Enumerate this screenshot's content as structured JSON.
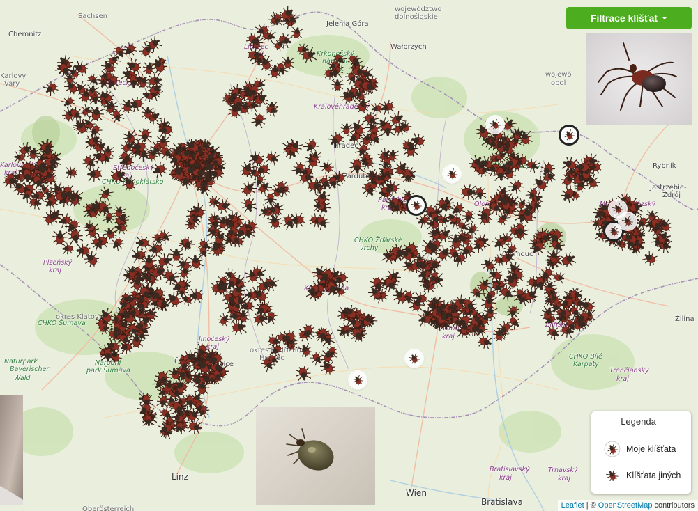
{
  "filter_button": {
    "label": "Filtrace klíšťat"
  },
  "legend": {
    "title": "Legenda",
    "own_label": "Moje klíšťata",
    "others_label": "Klíšťata jiných"
  },
  "attribution": {
    "leaflet": "Leaflet",
    "separator": "| ©",
    "osm": "OpenStreetMap",
    "contributors": "contributors"
  },
  "map_labels": [
    {
      "text": "Sachsen",
      "cls": ""
    },
    {
      "text": "Chemnitz",
      "cls": "city"
    },
    {
      "text": "Liberec",
      "cls": "region"
    },
    {
      "text": "kraj",
      "cls": "region"
    },
    {
      "text": "województwo",
      "cls": ""
    },
    {
      "text": "dolnośląskie",
      "cls": ""
    },
    {
      "text": "Jelenia Góra",
      "cls": "city"
    },
    {
      "text": "Wałbrzych",
      "cls": "city"
    },
    {
      "text": "Krkonošský",
      "cls": "green"
    },
    {
      "text": "národní",
      "cls": "green"
    },
    {
      "text": "park",
      "cls": "green"
    },
    {
      "text": "Ústecký",
      "cls": "region"
    },
    {
      "text": "Královéhradecký",
      "cls": "region"
    },
    {
      "text": "Hradec",
      "cls": "city"
    },
    {
      "text": "Pardubice",
      "cls": "city"
    },
    {
      "text": "Pardubický",
      "cls": "region"
    },
    {
      "text": "kraj",
      "cls": "region"
    },
    {
      "text": "Olomoucký",
      "cls": "region"
    },
    {
      "text": "Olomouc",
      "cls": "city"
    },
    {
      "text": "CHKO Jeseníky",
      "cls": "green"
    },
    {
      "text": "Moravskoslezský",
      "cls": "region"
    },
    {
      "text": "Středočeský",
      "cls": "region"
    },
    {
      "text": "kraj",
      "cls": "region"
    },
    {
      "text": "CHKO Křivoklátsko",
      "cls": "green"
    },
    {
      "text": "Plzeňský",
      "cls": "region"
    },
    {
      "text": "kraj",
      "cls": "region"
    },
    {
      "text": "Karlovarský",
      "cls": "region"
    },
    {
      "text": "kraj",
      "cls": "region"
    },
    {
      "text": "okres Klatovy",
      "cls": ""
    },
    {
      "text": "CHKO Šumava",
      "cls": "green"
    },
    {
      "text": "Naturpark",
      "cls": "green"
    },
    {
      "text": "Bayerischer",
      "cls": "green"
    },
    {
      "text": "Wald",
      "cls": "green"
    },
    {
      "text": "Národní",
      "cls": "green"
    },
    {
      "text": "park Šumava",
      "cls": "green"
    },
    {
      "text": "Jihočeský",
      "cls": "region"
    },
    {
      "text": "kraj",
      "cls": "region"
    },
    {
      "text": "České",
      "cls": "city"
    },
    {
      "text": "Budějovice",
      "cls": "city"
    },
    {
      "text": "okres Jindřichův",
      "cls": ""
    },
    {
      "text": "Hradec",
      "cls": ""
    },
    {
      "text": "Kraj Vysočina",
      "cls": "region"
    },
    {
      "text": "CHKO Žďárské",
      "cls": "green"
    },
    {
      "text": "vrchy",
      "cls": "green"
    },
    {
      "text": "Jihomoravský",
      "cls": "region"
    },
    {
      "text": "kraj",
      "cls": "region"
    },
    {
      "text": "Zlínský kraj",
      "cls": "region"
    },
    {
      "text": "CHKO Bílé",
      "cls": "green"
    },
    {
      "text": "Karpaty",
      "cls": "green"
    },
    {
      "text": "Trenčiansky",
      "cls": "region"
    },
    {
      "text": "kraj",
      "cls": "region"
    },
    {
      "text": "Žilina",
      "cls": "city"
    },
    {
      "text": "Rybník",
      "cls": "city"
    },
    {
      "text": "Jastrzębie-",
      "cls": "city"
    },
    {
      "text": "Zdrój",
      "cls": "city"
    },
    {
      "text": "wojewó",
      "cls": ""
    },
    {
      "text": "opol",
      "cls": ""
    },
    {
      "text": "Linz",
      "cls": "big"
    },
    {
      "text": "Wien",
      "cls": "big"
    },
    {
      "text": "Bratislava",
      "cls": "big"
    },
    {
      "text": "Bratislavský",
      "cls": "region"
    },
    {
      "text": "kraj",
      "cls": "region"
    },
    {
      "text": "Trnavský",
      "cls": "region"
    },
    {
      "text": "kraj",
      "cls": "region"
    },
    {
      "text": "Oberösterreich",
      "cls": ""
    },
    {
      "text": "Karlovy",
      "cls": ""
    },
    {
      "text": "Vary",
      "cls": ""
    }
  ],
  "icons": {
    "tick_marker": "tick-icon",
    "own_marker": "own-tick-icon",
    "caret": "caret-down-icon"
  },
  "colors": {
    "button": "#4cae1f",
    "tick_body": "#8a2f23",
    "tick_scutum": "#3a2a22",
    "link": "#0078a8"
  }
}
